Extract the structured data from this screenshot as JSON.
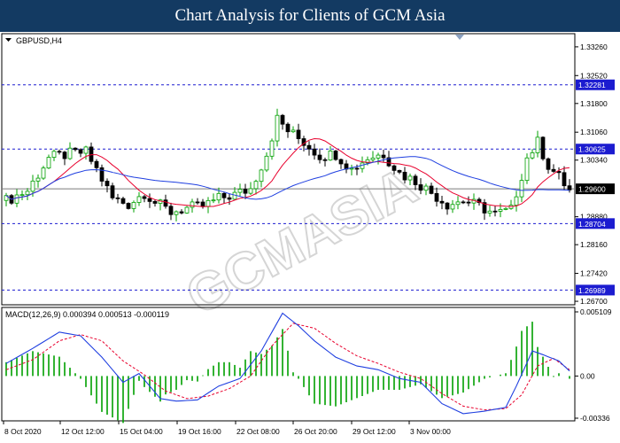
{
  "page_title": "Chart Analysis for Clients of GCM Asia",
  "watermark": "GCMASIA",
  "colors": {
    "banner": "#133a62",
    "bull_candle": "#00a000",
    "bear_candle": "#000000",
    "ma_fast": "#e8002d",
    "ma_slow": "#1f3fe0",
    "sr_line": "#1c1cd0",
    "current_price_line": "#7a7a7a",
    "macd_line": "#1f3fe0",
    "signal_line": "#e8002d",
    "histogram": "#00a000",
    "label_bg": "#1c1cd0"
  },
  "chart_data": [
    {
      "type": "candlestick",
      "title": "GBPUSD,H4",
      "ylim": [
        1.2661,
        1.336
      ],
      "y_ticks": [
        "1.33260",
        "1.32520",
        "1.31800",
        "1.31060",
        "1.30340",
        "1.28880",
        "1.28160",
        "1.27420",
        "1.26700"
      ],
      "x_ticks": [
        "8 Oct 2020",
        "12 Oct 12:00",
        "15 Oct 04:00",
        "19 Oct 16:00",
        "22 Oct 08:00",
        "26 Oct 20:00",
        "29 Oct 12:00",
        "3 Nov 00:00"
      ],
      "current_price": "1.29600",
      "levels": [
        {
          "label": "1.32281",
          "value": 1.32281
        },
        {
          "label": "1.30625",
          "value": 1.30625
        },
        {
          "label": "1.28704",
          "value": 1.28704
        },
        {
          "label": "1.26989",
          "value": 1.26989
        }
      ],
      "anchors": [
        [
          0,
          1.293
        ],
        [
          4,
          1.2955
        ],
        [
          8,
          1.304
        ],
        [
          12,
          1.305
        ],
        [
          15,
          1.3055
        ],
        [
          17,
          1.301
        ],
        [
          20,
          1.2935
        ],
        [
          23,
          1.292
        ],
        [
          26,
          1.295
        ],
        [
          28,
          1.2925
        ],
        [
          31,
          1.29
        ],
        [
          34,
          1.291
        ],
        [
          37,
          1.2915
        ],
        [
          40,
          1.2935
        ],
        [
          43,
          1.2945
        ],
        [
          46,
          1.296
        ],
        [
          49,
          1.305
        ],
        [
          51,
          1.314
        ],
        [
          53,
          1.311
        ],
        [
          56,
          1.308
        ],
        [
          59,
          1.3045
        ],
        [
          62,
          1.305
        ],
        [
          65,
          1.301
        ],
        [
          68,
          1.304
        ],
        [
          71,
          1.305
        ],
        [
          74,
          1.3
        ],
        [
          77,
          1.298
        ],
        [
          80,
          1.295
        ],
        [
          83,
          1.292
        ],
        [
          86,
          1.293
        ],
        [
          89,
          1.2915
        ],
        [
          92,
          1.2895
        ],
        [
          95,
          1.2905
        ],
        [
          98,
          1.304
        ],
        [
          100,
          1.308
        ],
        [
          102,
          1.302
        ],
        [
          104,
          1.299
        ],
        [
          106,
          1.2955
        ]
      ],
      "series": [
        {
          "name": "fast moving average",
          "period": 10
        },
        {
          "name": "slow moving average",
          "period": 30
        }
      ]
    },
    {
      "type": "macd",
      "title": "MACD(12,26,9) 0.000394 0.000513 -0.000119",
      "ylim": [
        -0.00336,
        0.005109
      ],
      "y_ticks": [
        "0.005109",
        "0.00",
        "-0.00336"
      ],
      "series": [
        {
          "name": "MACD",
          "anchors": [
            [
              0,
              0.001
            ],
            [
              5,
              0.0022
            ],
            [
              10,
              0.0035
            ],
            [
              14,
              0.0032
            ],
            [
              18,
              0.0015
            ],
            [
              22,
              -0.0005
            ],
            [
              25,
              0.0002
            ],
            [
              29,
              -0.0018
            ],
            [
              32,
              -0.002
            ],
            [
              36,
              -0.0019
            ],
            [
              40,
              -0.0008
            ],
            [
              44,
              -0.0002
            ],
            [
              48,
              0.002
            ],
            [
              52,
              0.005
            ],
            [
              55,
              0.004
            ],
            [
              58,
              0.0028
            ],
            [
              62,
              0.0015
            ],
            [
              66,
              0.0008
            ],
            [
              70,
              0.0005
            ],
            [
              74,
              -0.0002
            ],
            [
              78,
              -0.0005
            ],
            [
              82,
              -0.0022
            ],
            [
              86,
              -0.003
            ],
            [
              90,
              -0.0028
            ],
            [
              94,
              -0.0025
            ],
            [
              96,
              -0.0008
            ],
            [
              99,
              0.002
            ],
            [
              101,
              0.0017
            ],
            [
              104,
              0.0012
            ],
            [
              106,
              0.0004
            ]
          ]
        },
        {
          "name": "Signal",
          "anchors": [
            [
              0,
              0.0005
            ],
            [
              5,
              0.0013
            ],
            [
              10,
              0.0028
            ],
            [
              14,
              0.0033
            ],
            [
              18,
              0.0028
            ],
            [
              22,
              0.0012
            ],
            [
              26,
              0.0001
            ],
            [
              30,
              -0.0012
            ],
            [
              34,
              -0.0018
            ],
            [
              38,
              -0.0016
            ],
            [
              42,
              -0.001
            ],
            [
              46,
              0.0
            ],
            [
              50,
              0.0024
            ],
            [
              54,
              0.0042
            ],
            [
              58,
              0.0038
            ],
            [
              62,
              0.0026
            ],
            [
              66,
              0.0016
            ],
            [
              70,
              0.001
            ],
            [
              74,
              0.0003
            ],
            [
              78,
              -0.0002
            ],
            [
              82,
              -0.0014
            ],
            [
              86,
              -0.0024
            ],
            [
              90,
              -0.0027
            ],
            [
              94,
              -0.0026
            ],
            [
              97,
              -0.0015
            ],
            [
              100,
              0.0008
            ],
            [
              103,
              0.0014
            ],
            [
              106,
              0.0005
            ]
          ]
        }
      ]
    }
  ]
}
